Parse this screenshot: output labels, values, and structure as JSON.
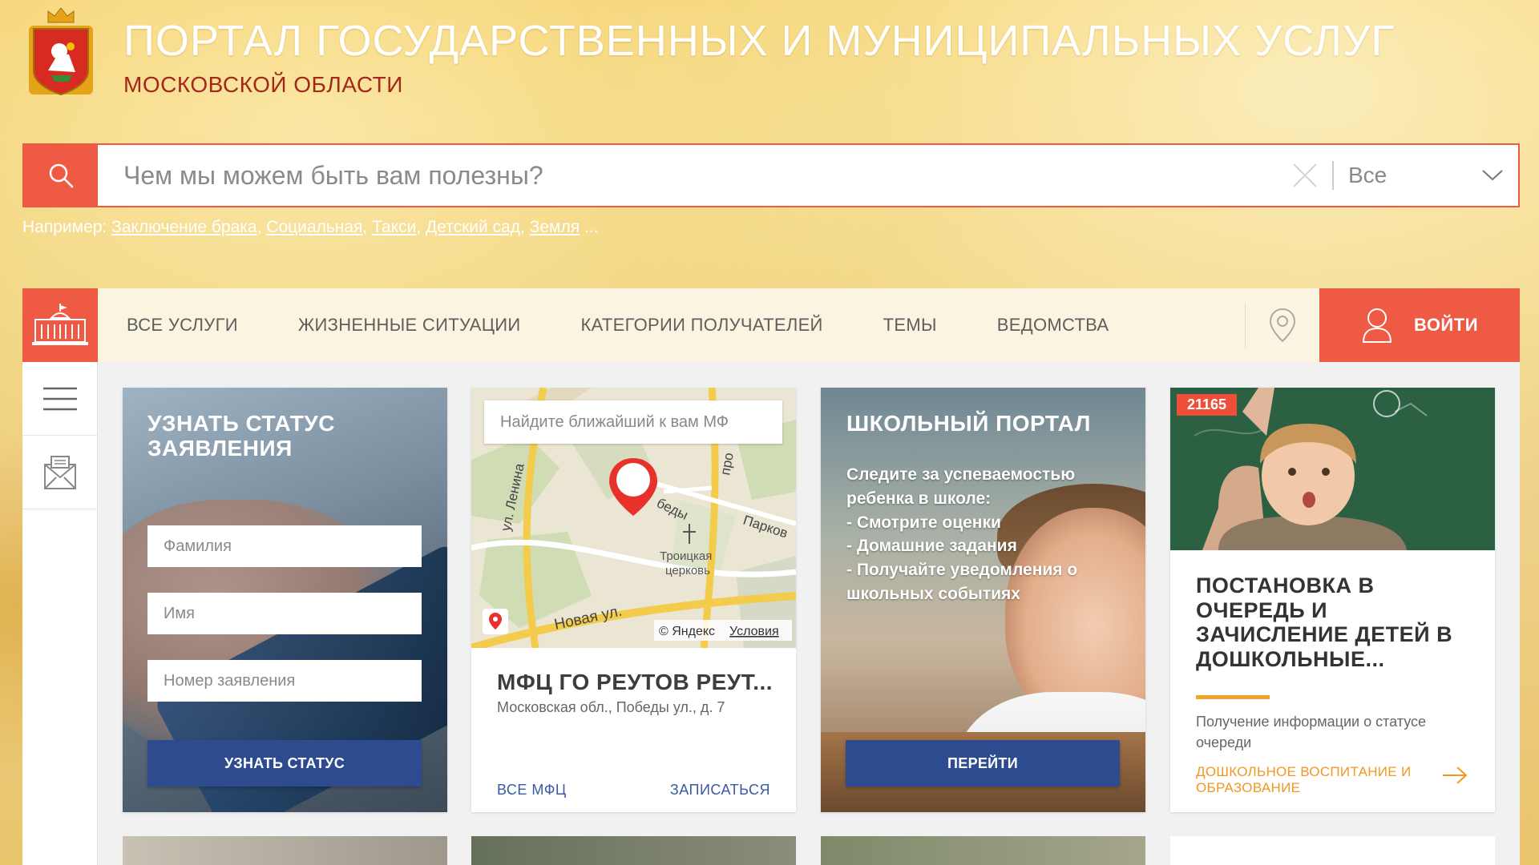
{
  "header": {
    "title": "ПОРТАЛ ГОСУДАРСТВЕННЫХ И МУНИЦИПАЛЬНЫХ УСЛУГ",
    "subtitle": "МОСКОВСКОЙ ОБЛАСТИ"
  },
  "search": {
    "placeholder": "Чем мы можем быть вам полезны?",
    "category": "Все",
    "examples_label": "Например:",
    "examples": [
      "Заключение брака",
      "Социальная",
      "Такси",
      "Детский сад",
      "Земля"
    ],
    "ellipsis": "..."
  },
  "nav": {
    "items": [
      "ВСЕ УСЛУГИ",
      "ЖИЗНЕННЫЕ СИТУАЦИИ",
      "КАТЕГОРИИ ПОЛУЧАТЕЛЕЙ",
      "ТЕМЫ",
      "ВЕДОМСТВА"
    ],
    "login": "ВОЙТИ"
  },
  "status_card": {
    "title_line1": "УЗНАТЬ СТАТУС",
    "title_line2": "ЗАЯВЛЕНИЯ",
    "surname_placeholder": "Фамилия",
    "name_placeholder": "Имя",
    "number_placeholder": "Номер заявления",
    "button": "УЗНАТЬ СТАТУС"
  },
  "mfc_card": {
    "map_search": "Найдите ближайший к вам МФ",
    "map_labels": {
      "street1": "ул. Ленина",
      "street2": "беды",
      "street3": "Парков",
      "street4": "Новая ул.",
      "street5": "про",
      "church": "Троицкая",
      "church2": "церковь",
      "yandex": "© Яндекс",
      "terms": "Условия"
    },
    "title": "МФЦ ГО РЕУТОВ РЕУТ...",
    "address": "Московская обл., Победы ул., д. 7",
    "all_link": "ВСЕ МФЦ",
    "signup_link": "ЗАПИСАТЬСЯ"
  },
  "school_card": {
    "title": "ШКОЛЬНЫЙ ПОРТАЛ",
    "lines": [
      "Следите за успеваемостью",
      "ребенка в школе:",
      "- Смотрите оценки",
      "- Домашние задания",
      "- Получайте уведомления о",
      "школьных событиях"
    ],
    "button": "ПЕРЕЙТИ"
  },
  "kinder_card": {
    "badge": "21165",
    "title": "ПОСТАНОВКА В ОЧЕРЕДЬ И ЗАЧИСЛЕНИЕ ДЕТЕЙ В ДОШКОЛЬНЫЕ...",
    "description": "Получение информации о статусе очереди",
    "category": "ДОШКОЛЬНОЕ ВОСПИТАНИЕ И ОБРАЗОВАНИЕ"
  },
  "colors": {
    "accent": "#ef5a45",
    "blue_button": "#2e4b8f",
    "link_blue": "#3b5aa5",
    "orange": "#f29722"
  }
}
